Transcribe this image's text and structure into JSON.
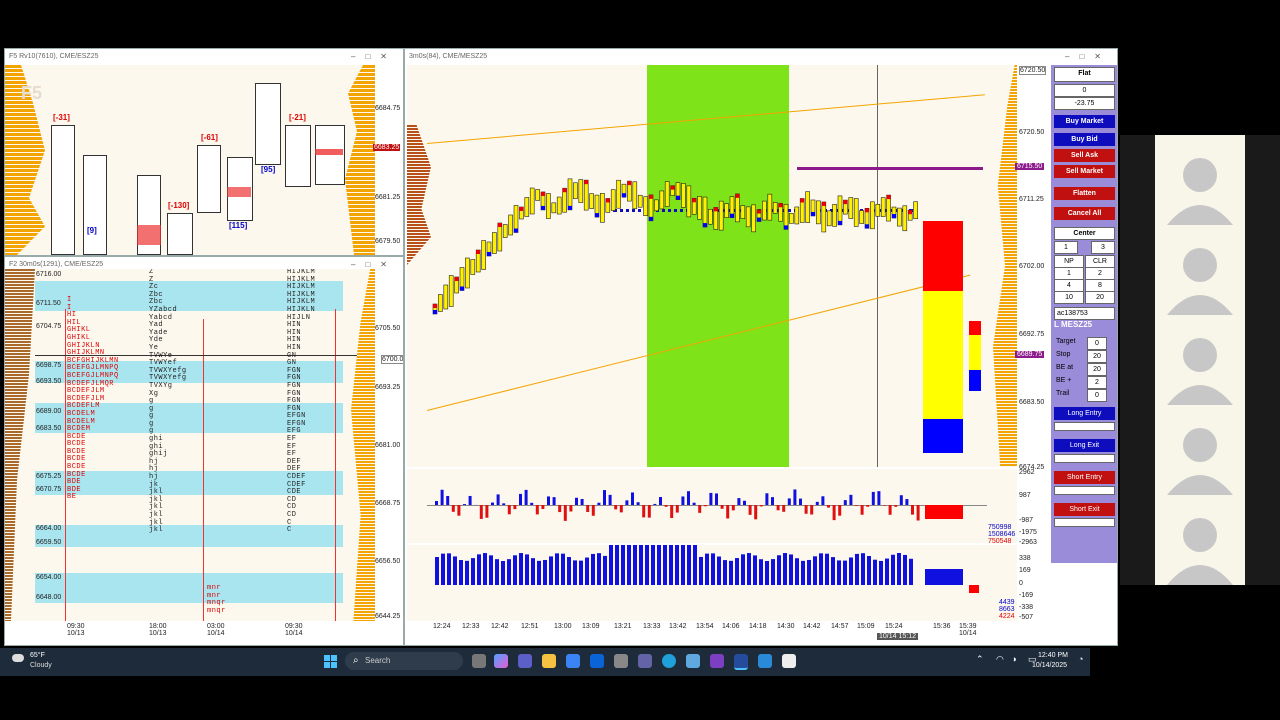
{
  "windows": {
    "f5_title": "F5 Rv10(7610), CME/ESZ25",
    "f2_title": "F2 30m0s(1291), CME/ESZ25",
    "main_title": "3m0s(84), CME/MESZ25"
  },
  "f5": {
    "watermark": "F5",
    "prices": [
      "6684.75",
      "6683.25",
      "6681.25",
      "6679.50"
    ],
    "labels": [
      "[-31]",
      "[9]",
      "[-130]",
      "[-61]",
      "[115]",
      "[-21]",
      "[95]"
    ]
  },
  "f2": {
    "left_prices": [
      "6716.00",
      "6711.50",
      "6704.75",
      "6698.75",
      "6693.50",
      "6689.00",
      "6683.50",
      "6675.25",
      "6670.75",
      "6664.00",
      "6659.50",
      "6654.00",
      "6648.00"
    ],
    "right_prices": [
      "6705.50",
      "6700.00",
      "6693.25",
      "6681.00",
      "6668.75",
      "6656.50",
      "6644.25"
    ],
    "time_labels": [
      "09:30\n10/13",
      "18:00\n10/13",
      "03:00\n10/14",
      "09:30\n10/14"
    ]
  },
  "main": {
    "price_axis": [
      "6720.50",
      "6720.50",
      "6711.25",
      "6702.00",
      "6692.75",
      "6683.50",
      "6674.25"
    ],
    "price_tags": {
      "last": "6715.50",
      "current": "6689.75"
    },
    "osc1_axis": [
      "2962",
      "987",
      "-987",
      "-1975",
      "-2963"
    ],
    "osc1_values": [
      "750998",
      "1508646",
      "750548"
    ],
    "osc2_axis": [
      "338",
      "169",
      "0",
      "-169",
      "-338",
      "-507"
    ],
    "osc2_values": [
      "4439",
      "8663",
      "4224"
    ],
    "time_labels": [
      "12:24",
      "12:33",
      "12:42",
      "12:51",
      "13:00",
      "13:09",
      "13:21",
      "13:33",
      "13:42",
      "13:54",
      "14:06",
      "14:18",
      "14:30",
      "14:42",
      "14:57",
      "15:09",
      "15:24",
      "15:36",
      "15:39\n10/14"
    ],
    "cursor_time": "10/14 15:12"
  },
  "trade_panel": {
    "status": "Flat",
    "position": "0",
    "pnl": "-23.75",
    "buy_market": "Buy Market",
    "buy_bid": "Buy Bid",
    "sell_ask": "Sell Ask",
    "sell_market": "Sell Market",
    "flatten": "Flatten",
    "cancel_all": "Cancel All",
    "center": "Center",
    "qty_a": "1",
    "qty_b": "3",
    "np": "NP",
    "clr": "CLR",
    "grid": [
      "1",
      "2",
      "4",
      "8",
      "10",
      "20"
    ],
    "account": "ac138753",
    "symbol": "L MESZ25",
    "target_label": "Target",
    "target_val": "0",
    "stop_label": "Stop",
    "stop_val": "20",
    "beat_label": "BE at",
    "beat_val": "20",
    "beplus_label": "BE +",
    "beplus_val": "2",
    "trail_label": "Trail",
    "trail_val": "0",
    "long_entry": "Long Entry",
    "long_exit": "Long Exit",
    "short_entry": "Short Entry",
    "short_exit": "Short Exit"
  },
  "taskbar": {
    "weather_temp": "65°F",
    "weather_desc": "Cloudy",
    "search_placeholder": "Search",
    "time": "12:40 PM",
    "date": "10/14/2025"
  },
  "colors": {
    "highlight_green": "#7fe31a",
    "buy_blue": "#0d0dbd",
    "sell_red": "#c11010",
    "panel_purple": "#9a8cd8",
    "profile_orange": "#f3a400"
  }
}
